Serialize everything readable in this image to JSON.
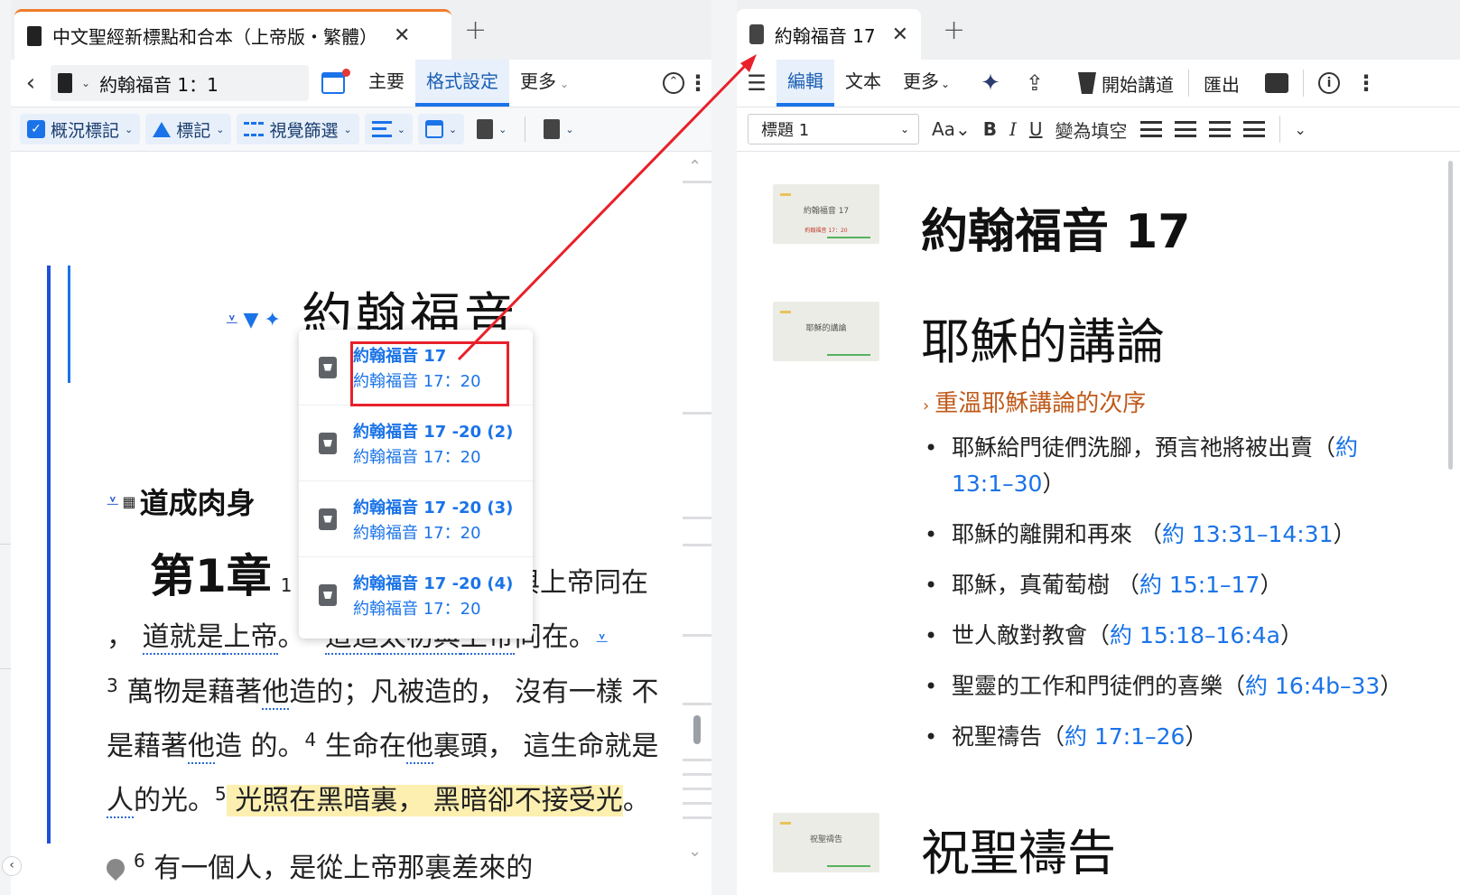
{
  "left": {
    "tab": {
      "title": "中文聖經新標點和合本（上帝版・繁體）",
      "close": "✕",
      "add": "+"
    },
    "nav": {
      "back": "‹",
      "book_ref": "約翰福音 1：1",
      "chev": "⌄"
    },
    "menu": {
      "main": "主要",
      "format": "格式設定",
      "more": "更多",
      "more_chev": "⌄",
      "kebab": "⋮"
    },
    "format_bar": {
      "overview_marks": "概況標記",
      "marks": "標記",
      "visual_filter": "視覺篩選",
      "chev": "⌄"
    },
    "content": {
      "book_title": "約翰福音",
      "section_heading": "道成肉身",
      "chapter_label": "第1章",
      "v1_num": "1",
      "chapter_line_cont": "與上帝同在",
      "verses": {
        "line1_pre": "，",
        "line1_a": "道就是",
        "line1_b": "上帝",
        "line1_c": "。",
        "v2": "2",
        "line1_d": "這道",
        "line1_e": "太初與",
        "line1_f": "上帝",
        "line1_g": "同在。",
        "v3": "3",
        "line2_a": " 萬物是藉著",
        "line2_b": "他",
        "line2_c": "造的；凡被造的， 沒有一樣 不是藉著",
        "line2_d": "他",
        "line2_e": "造 的。",
        "v4": "4",
        "line2_f": " 生命在",
        "line2_g": "他",
        "line2_h": "裏頭， 這生命就是",
        "line2_i": "人",
        "line2_j": "的光。",
        "v5": "5",
        "line3_hl": " 光照在黑暗裏， 黑暗卻不接受光",
        "line3_end": "。"
      },
      "verse6_num": "6",
      "verse6_text": " 有一個人，是從上帝那裏差來的"
    },
    "popup": {
      "items": [
        {
          "title": "約翰福音 17",
          "sub": "約翰福音 17：20"
        },
        {
          "title": "約翰福音 17 -20 (2)",
          "sub": "約翰福音 17：20"
        },
        {
          "title": "約翰福音 17 -20 (3)",
          "sub": "約翰福音 17：20"
        },
        {
          "title": "約翰福音 17 -20 (4)",
          "sub": "約翰福音 17：20"
        }
      ]
    },
    "collapse": "‹"
  },
  "right": {
    "tab": {
      "title": "約翰福音 17",
      "close": "✕",
      "add": "+"
    },
    "menu": {
      "hamburger": "☰",
      "edit": "編輯",
      "text": "文本",
      "more": "更多",
      "more_chev": "⌄",
      "sparkle": "✦",
      "share": "⇪",
      "start_presentation": "開始講道",
      "export": "匯出",
      "info": "i",
      "kebab": "⋮"
    },
    "format_bar": {
      "style": "標題 1",
      "style_chev": "⌄",
      "font_size": "Aa⌄",
      "bold": "B",
      "italic": "I",
      "underline": "U",
      "cloze": "變為填空",
      "expand": "⌄"
    },
    "doc": {
      "thumbs": [
        {
          "text": "約翰福音 17",
          "sub": "約翰福音 17：20"
        },
        {
          "text": "耶穌的講論",
          "sub": ""
        },
        {
          "text": "祝聖禱告",
          "sub": ""
        }
      ],
      "title": "約翰福音 17",
      "h1": "耶穌的講論",
      "subhead": "重溫耶穌講論的次序",
      "subhead_arrow": "›",
      "list": [
        {
          "text": "耶穌給門徒們洗腳，預言祂將被出賣（",
          "ref": "約 13:1–30",
          "tail": "）"
        },
        {
          "text": "耶穌的離開和再來 （",
          "ref": "約 13:31–14:31",
          "tail": "）"
        },
        {
          "text": "耶穌，真葡萄樹 （",
          "ref": "約 15:1–17",
          "tail": "）"
        },
        {
          "text": "世人敵對教會（",
          "ref": "約 15:18–16:4a",
          "tail": "）"
        },
        {
          "text": "聖靈的工作和門徒們的喜樂（",
          "ref": "約 16:4b–33",
          "tail": "）"
        },
        {
          "text": "祝聖禱告（",
          "ref": "約 17:1–26",
          "tail": "）"
        }
      ],
      "h2": "祝聖禱告"
    }
  },
  "colors": {
    "accent": "#1a73e8",
    "tab_accent": "#f07b2a",
    "annotation": "#e8202a",
    "highlight": "#fcefb0",
    "subhead": "#c05a1a"
  }
}
